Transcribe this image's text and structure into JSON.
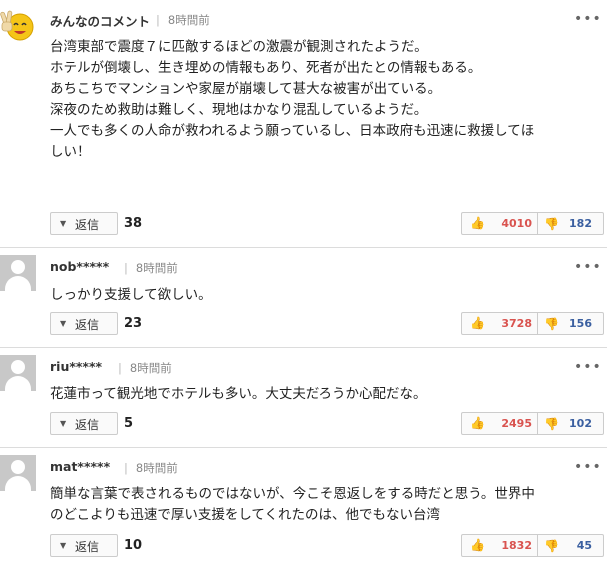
{
  "comments": [
    {
      "username": "みんなのコメント",
      "time": "8時間前",
      "avatar": "smiley-peace-avatar",
      "lines": [
        "台湾東部で震度７に匹敵するほどの激震が観測されたようだ。",
        "",
        "ホテルが倒壊し、生き埋めの情報もあり、死者が出たとの情報もある。",
        "あちこちでマンションや家屋が崩壊して甚大な被害が出ている。",
        "深夜のため救助は難しく、現地はかなり混乱しているようだ。",
        "",
        "一人でも多くの人命が救われるよう願っているし、日本政府も迅速に救援してほ",
        "しい！"
      ],
      "reply_label": "返信",
      "reply_count": "38",
      "up_votes": "4010",
      "down_votes": "182"
    },
    {
      "username": "nob*****",
      "time": "8時間前",
      "avatar": "default-user-avatar",
      "lines": [
        "しっかり支援して欲しい。"
      ],
      "reply_label": "返信",
      "reply_count": "23",
      "up_votes": "3728",
      "down_votes": "156"
    },
    {
      "username": "riu*****",
      "time": "8時間前",
      "avatar": "default-user-avatar",
      "lines": [
        "花蓮市って観光地でホテルも多い。大丈夫だろうか心配だな。"
      ],
      "reply_label": "返信",
      "reply_count": "5",
      "up_votes": "2495",
      "down_votes": "102"
    },
    {
      "username": "mat*****",
      "time": "8時間前",
      "avatar": "default-user-avatar",
      "lines": [
        "簡単な言葉で表されるものではないが、今こそ恩返しをする時だと思う。世界中",
        "のどこよりも迅速で厚い支援をしてくれたのは、他でもない台湾"
      ],
      "reply_label": "返信",
      "reply_count": "10",
      "up_votes": "1832",
      "down_votes": "45"
    }
  ],
  "icons": {
    "more": "more-options-icon",
    "reply_toggle": "triangle-down-icon",
    "thumbs_up": "thumbs-up-icon",
    "thumbs_down": "thumbs-down-icon"
  },
  "colors": {
    "up_votes": "#d9534f",
    "down_votes": "#3a5fa0",
    "separator": "#dcdcdc"
  }
}
